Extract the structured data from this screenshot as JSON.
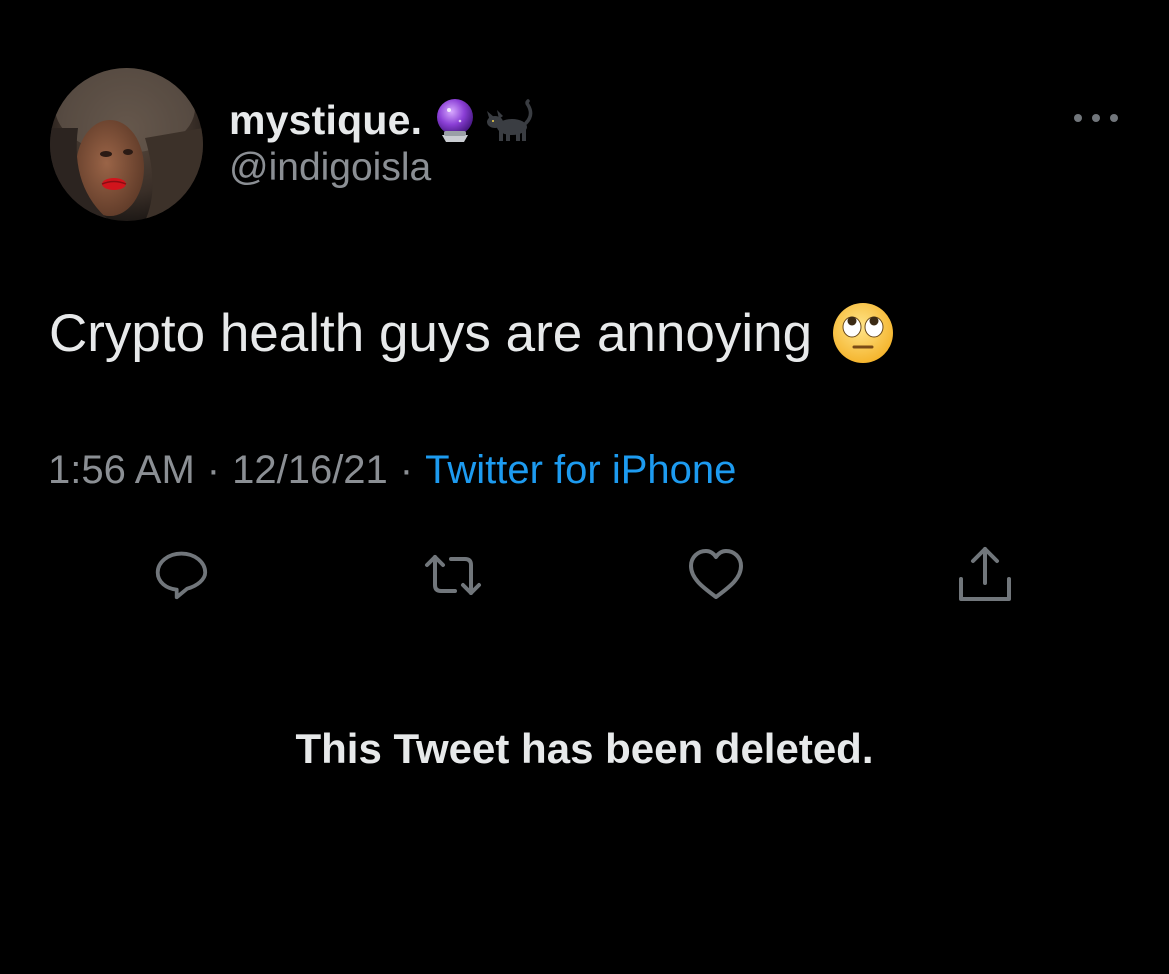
{
  "author": {
    "display_name": "mystique.",
    "handle": "@indigoisla",
    "name_emojis": [
      "crystal-ball-icon",
      "black-cat-icon"
    ]
  },
  "tweet": {
    "text": "Crypto health guys are annoying",
    "text_emoji": "face-with-rolling-eyes-icon",
    "time": "1:56 AM",
    "date": "12/16/21",
    "separator": "·",
    "source": "Twitter for iPhone"
  },
  "actions": [
    {
      "name": "reply",
      "icon": "reply-icon"
    },
    {
      "name": "retweet",
      "icon": "retweet-icon"
    },
    {
      "name": "like",
      "icon": "heart-icon"
    },
    {
      "name": "share",
      "icon": "share-icon"
    }
  ],
  "notice": {
    "deleted_text": "This Tweet has been deleted."
  },
  "colors": {
    "background": "#000000",
    "primary_text": "#e7e9ea",
    "secondary_text": "#8b8f94",
    "link": "#1d9bf0",
    "icon": "#71767b"
  }
}
